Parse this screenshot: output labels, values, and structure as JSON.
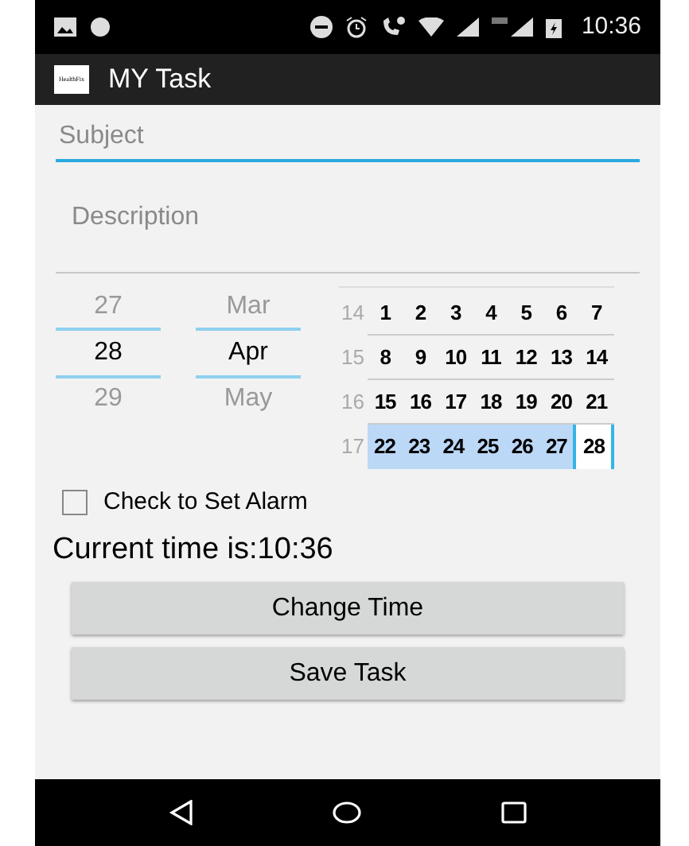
{
  "status_bar": {
    "time": "10:36"
  },
  "app_bar": {
    "logo_text": "HealthFix",
    "title": "MY Task"
  },
  "subject": {
    "placeholder": "Subject"
  },
  "description": {
    "placeholder": "Description"
  },
  "day_picker": [
    {
      "label": "27",
      "selected": false
    },
    {
      "label": "28",
      "selected": true
    },
    {
      "label": "29",
      "selected": false
    }
  ],
  "month_picker": [
    {
      "label": "Mar",
      "selected": false
    },
    {
      "label": "Apr",
      "selected": true
    },
    {
      "label": "May",
      "selected": false
    }
  ],
  "calendar": {
    "weeks": [
      {
        "number": "14",
        "days": [
          {
            "label": "1",
            "highlighted": false,
            "selected": false
          },
          {
            "label": "2",
            "highlighted": false,
            "selected": false
          },
          {
            "label": "3",
            "highlighted": false,
            "selected": false
          },
          {
            "label": "4",
            "highlighted": false,
            "selected": false
          },
          {
            "label": "5",
            "highlighted": false,
            "selected": false
          },
          {
            "label": "6",
            "highlighted": false,
            "selected": false
          },
          {
            "label": "7",
            "highlighted": false,
            "selected": false
          }
        ]
      },
      {
        "number": "15",
        "days": [
          {
            "label": "8",
            "highlighted": false,
            "selected": false
          },
          {
            "label": "9",
            "highlighted": false,
            "selected": false
          },
          {
            "label": "10",
            "highlighted": false,
            "selected": false
          },
          {
            "label": "11",
            "highlighted": false,
            "selected": false
          },
          {
            "label": "12",
            "highlighted": false,
            "selected": false
          },
          {
            "label": "13",
            "highlighted": false,
            "selected": false
          },
          {
            "label": "14",
            "highlighted": false,
            "selected": false
          }
        ]
      },
      {
        "number": "16",
        "days": [
          {
            "label": "15",
            "highlighted": false,
            "selected": false
          },
          {
            "label": "16",
            "highlighted": false,
            "selected": false
          },
          {
            "label": "17",
            "highlighted": false,
            "selected": false
          },
          {
            "label": "18",
            "highlighted": false,
            "selected": false
          },
          {
            "label": "19",
            "highlighted": false,
            "selected": false
          },
          {
            "label": "20",
            "highlighted": false,
            "selected": false
          },
          {
            "label": "21",
            "highlighted": false,
            "selected": false
          }
        ]
      },
      {
        "number": "17",
        "days": [
          {
            "label": "22",
            "highlighted": true,
            "selected": false
          },
          {
            "label": "23",
            "highlighted": true,
            "selected": false
          },
          {
            "label": "24",
            "highlighted": true,
            "selected": false
          },
          {
            "label": "25",
            "highlighted": true,
            "selected": false
          },
          {
            "label": "26",
            "highlighted": true,
            "selected": false
          },
          {
            "label": "27",
            "highlighted": true,
            "selected": false
          },
          {
            "label": "28",
            "highlighted": false,
            "selected": true
          }
        ]
      }
    ]
  },
  "alarm": {
    "label": "Check to Set Alarm",
    "checked": false
  },
  "current_time": "Current time is:10:36",
  "buttons": [
    "Change Time",
    "Save Task"
  ]
}
